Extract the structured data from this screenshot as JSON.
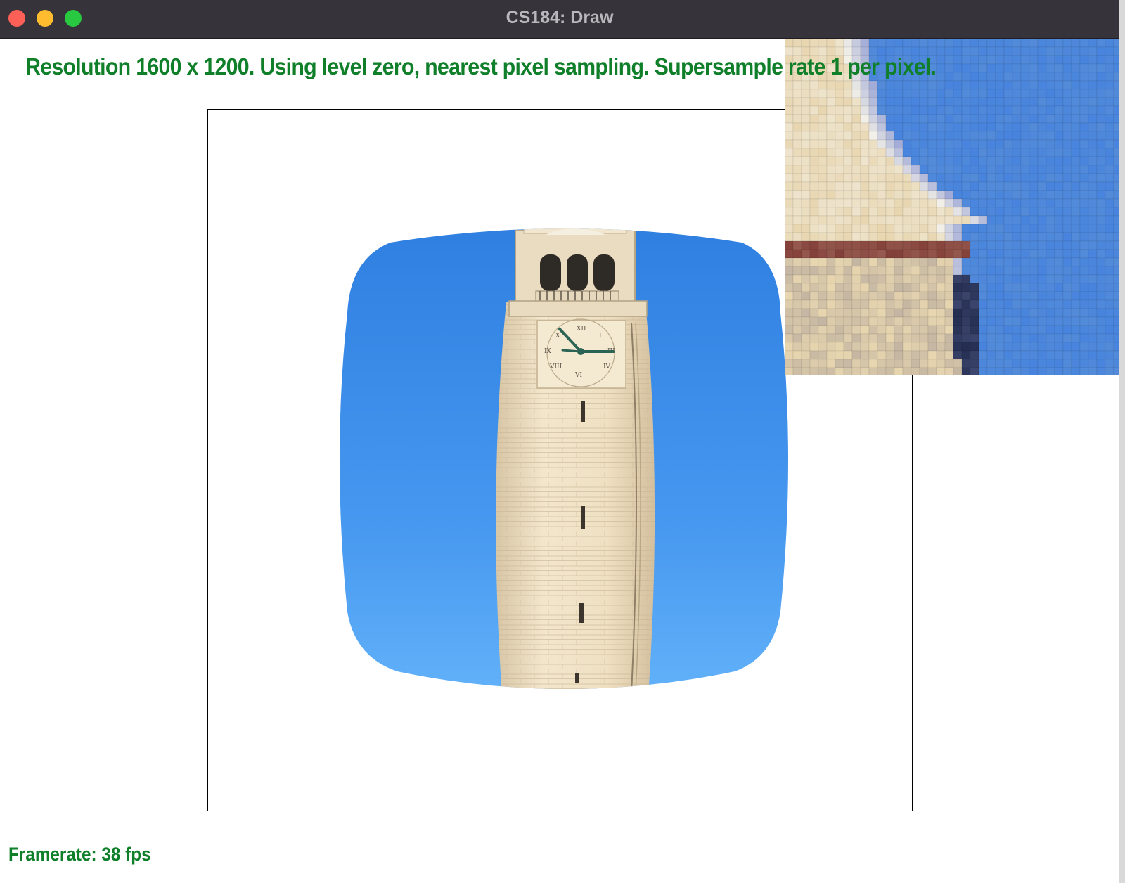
{
  "window": {
    "title": "CS184: Draw",
    "controls": [
      "close",
      "minimize",
      "maximize"
    ]
  },
  "status": {
    "info_text": "Resolution 1600 x 1200. Using level zero, nearest pixel sampling. Supersample rate 1 per pixel.",
    "framerate_text": "Framerate: 38 fps"
  },
  "colors": {
    "status_text": "#0f7f2a",
    "titlebar": "#36333a",
    "sky": "#3e8eea",
    "tower": "#efe0c2"
  }
}
